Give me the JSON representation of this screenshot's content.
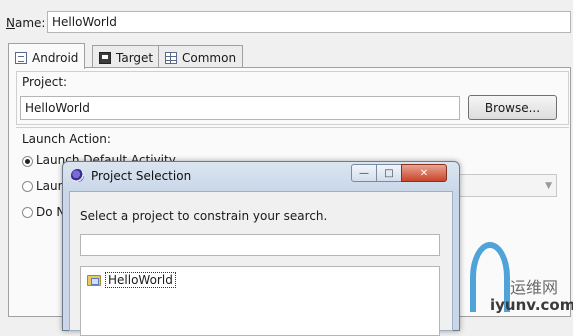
{
  "name_row": {
    "label_underlined": "N",
    "label_rest": "ame:",
    "value": "HelloWorld"
  },
  "tabs": [
    {
      "label": "Android",
      "icon": "document-icon",
      "active": true
    },
    {
      "label": "Target",
      "icon": "target-device-icon",
      "active": false
    },
    {
      "label": "Common",
      "icon": "grid-icon",
      "active": false
    }
  ],
  "project": {
    "label": "Project:",
    "value": "HelloWorld",
    "browse_label": "Browse..."
  },
  "launch_action": {
    "label": "Launch Action:",
    "options": [
      {
        "label": "Launch Default Activity",
        "checked": true
      },
      {
        "label": "Laun",
        "checked": false
      },
      {
        "label": "Do N",
        "checked": false
      }
    ]
  },
  "dialog": {
    "title": "Project Selection",
    "prompt": "Select a project to constrain your search.",
    "search_value": "",
    "items": [
      {
        "label": "HelloWorld",
        "icon": "project-folder-icon"
      }
    ],
    "window_buttons": {
      "minimize": "—",
      "maximize": "□",
      "close": "✕"
    }
  },
  "watermark": {
    "chinese": "运维网",
    "url": "iyunv.com",
    "accent": "#4fa3d8"
  }
}
